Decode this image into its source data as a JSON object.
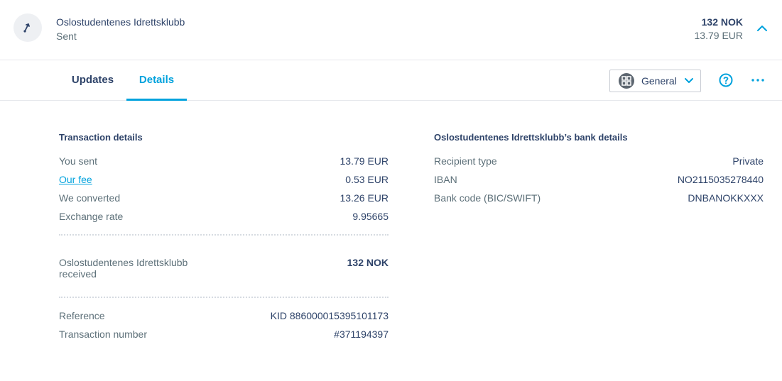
{
  "header": {
    "recipient_name": "Oslostudentenes Idrettsklubb",
    "status": "Sent",
    "amount_received": "132 NOK",
    "amount_sent": "13.79 EUR",
    "icon": "arrow-up-right-icon",
    "collapse_icon": "chevron-up-icon"
  },
  "tabs": [
    {
      "label": "Updates",
      "active": false
    },
    {
      "label": "Details",
      "active": true
    }
  ],
  "toolbar": {
    "view_select": "General",
    "help_icon": "question-circle-icon",
    "more_icon": "more-dots-icon"
  },
  "transaction": {
    "title": "Transaction details",
    "rows": [
      {
        "label": "You sent",
        "value": "13.79 EUR"
      },
      {
        "label": "Our fee",
        "value": "0.53 EUR"
      },
      {
        "label": "We converted",
        "value": "13.26 EUR"
      },
      {
        "label": "Exchange rate",
        "value": "9.95665"
      }
    ],
    "received_label_line1": "Oslostudentenes Idrettsklubb",
    "received_label_line2": "received",
    "received_value": "132 NOK",
    "reference_label": "Reference",
    "reference_value": "KID 886000015395101173",
    "txn_number_label": "Transaction number",
    "txn_number_value": "#371194397"
  },
  "bank": {
    "title": "Oslostudentenes Idrettsklubb’s bank details",
    "rows": [
      {
        "label": "Recipient type",
        "value": "Private"
      },
      {
        "label": "IBAN",
        "value": "NO2115035278440"
      },
      {
        "label": "Bank code (BIC/SWIFT)",
        "value": "DNBANOKKXXX"
      }
    ]
  },
  "colors": {
    "accent": "#00a2dd",
    "text_dark": "#2e4369",
    "text_muted": "#5d7079"
  }
}
